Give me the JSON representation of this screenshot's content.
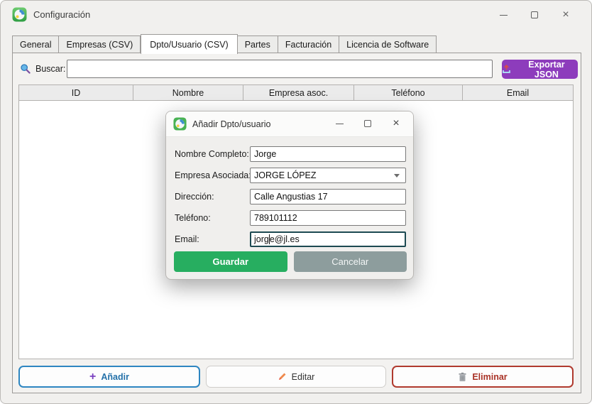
{
  "window": {
    "title": "Configuración",
    "controls": {
      "minimize": "minimize",
      "maximize": "maximize",
      "close": "×"
    }
  },
  "tabs": [
    {
      "label": "General",
      "active": false
    },
    {
      "label": "Empresas (CSV)",
      "active": false
    },
    {
      "label": "Dpto/Usuario (CSV)",
      "active": true
    },
    {
      "label": "Partes",
      "active": false
    },
    {
      "label": "Facturación",
      "active": false
    },
    {
      "label": "Licencia de Software",
      "active": false
    }
  ],
  "toolbar": {
    "search_label": "Buscar:",
    "search_value": "",
    "export_label": "Exportar JSON"
  },
  "table": {
    "columns": [
      "ID",
      "Nombre",
      "Empresa asoc.",
      "Teléfono",
      "Email"
    ],
    "rows": []
  },
  "footer": {
    "add_label": "Añadir",
    "add_plus": "+",
    "edit_label": "Editar",
    "delete_label": "Eliminar"
  },
  "dialog": {
    "title": "Añadir Dpto/usuario",
    "controls": {
      "close": "×"
    },
    "fields": [
      {
        "label": "Nombre Completo:",
        "value": "Jorge",
        "type": "text"
      },
      {
        "label": "Empresa Asociada:",
        "value": "JORGE LÓPEZ",
        "type": "combobox"
      },
      {
        "label": "Dirección:",
        "value": "Calle Angustias 17",
        "type": "text"
      },
      {
        "label": "Teléfono:",
        "value": "789101112",
        "type": "text"
      },
      {
        "label": "Email:",
        "value": "jorge@jl.es",
        "type": "text",
        "focused": true,
        "caret_before": "jorg",
        "caret_after": "e@jl.es"
      }
    ],
    "buttons": {
      "save": "Guardar",
      "cancel": "Cancelar"
    }
  },
  "colors": {
    "export_purple": "#8d3cbc",
    "save_green": "#27ae60",
    "cancel_gray": "#8d9d9d",
    "add_blue": "#2e86c1",
    "delete_red": "#b03a2e",
    "window_bg": "#f1f0ee"
  }
}
